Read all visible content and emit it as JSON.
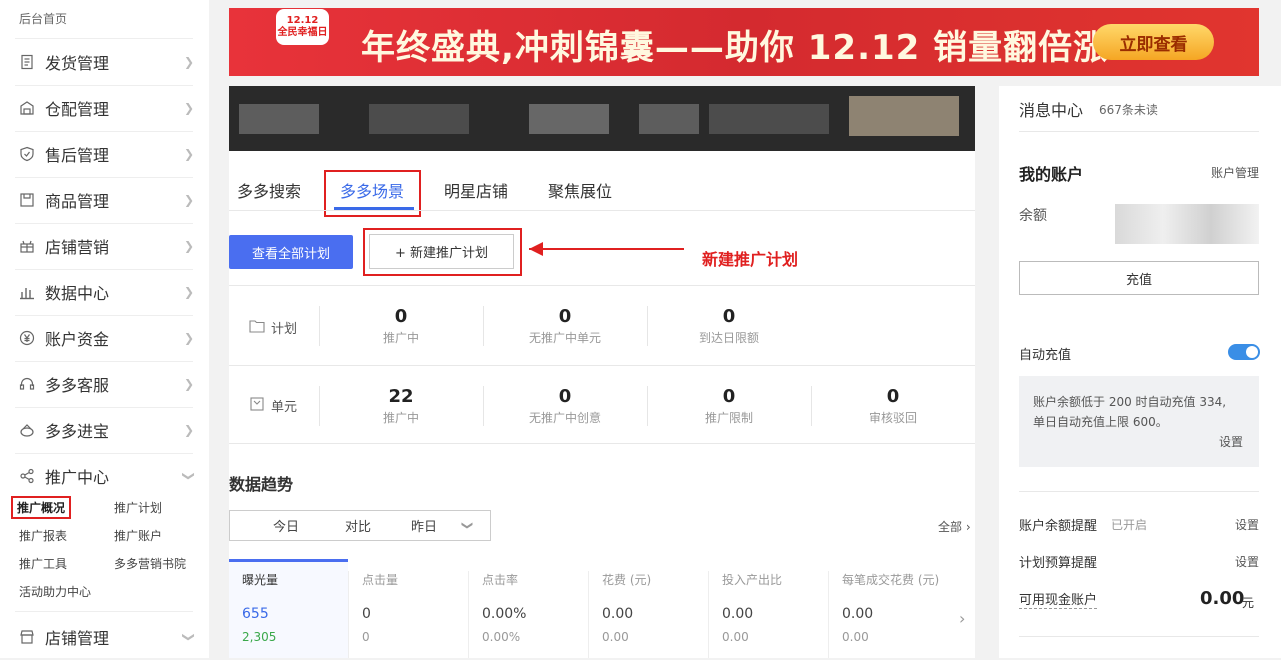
{
  "sidebar": {
    "home": "后台首页",
    "items": [
      {
        "label": "发货管理",
        "icon": "document-icon"
      },
      {
        "label": "仓配管理",
        "icon": "warehouse-icon"
      },
      {
        "label": "售后管理",
        "icon": "shield-icon"
      },
      {
        "label": "商品管理",
        "icon": "product-icon"
      },
      {
        "label": "店铺营销",
        "icon": "gift-icon"
      },
      {
        "label": "数据中心",
        "icon": "bar-chart-icon"
      },
      {
        "label": "账户资金",
        "icon": "yen-icon"
      },
      {
        "label": "多多客服",
        "icon": "headset-icon"
      },
      {
        "label": "多多进宝",
        "icon": "treasure-icon"
      },
      {
        "label": "推广中心",
        "icon": "share-icon"
      }
    ],
    "promo_sub": [
      "推广概况",
      "推广计划",
      "推广报表",
      "推广账户",
      "推广工具",
      "多多营销书院",
      "活动助力中心"
    ],
    "last_item": "店铺管理"
  },
  "banner": {
    "logo_line1": "12.12",
    "logo_line2": "全民幸福日",
    "headline": "年终盛典,冲刺锦囊——助你 12.12 销量翻倍涨!",
    "button": "立即查看"
  },
  "tabs": [
    "多多搜索",
    "多多场景",
    "明星店铺",
    "聚焦展位"
  ],
  "actions": {
    "view_all": "查看全部计划",
    "new_plan": "+ 新建推广计划"
  },
  "annotation": "新建推广计划",
  "plan_stats": {
    "label": "计划",
    "cells": [
      {
        "value": "0",
        "caption": "推广中"
      },
      {
        "value": "0",
        "caption": "无推广中单元"
      },
      {
        "value": "0",
        "caption": "到达日限额"
      }
    ]
  },
  "unit_stats": {
    "label": "单元",
    "cells": [
      {
        "value": "22",
        "caption": "推广中"
      },
      {
        "value": "0",
        "caption": "无推广中创意"
      },
      {
        "value": "0",
        "caption": "推广限制"
      },
      {
        "value": "0",
        "caption": "审核驳回"
      }
    ]
  },
  "trend": {
    "title": "数据趋势",
    "seg_today": "今日",
    "seg_compare": "对比",
    "seg_yesterday": "昨日",
    "all_link": "全部",
    "metrics": [
      {
        "name": "曝光量",
        "value": "655",
        "prev": "2,305"
      },
      {
        "name": "点击量",
        "value": "0",
        "prev": "0"
      },
      {
        "name": "点击率",
        "value": "0.00%",
        "prev": "0.00%"
      },
      {
        "name": "花费 (元)",
        "value": "0.00",
        "prev": "0.00"
      },
      {
        "name": "投入产出比",
        "value": "0.00",
        "prev": "0.00"
      },
      {
        "name": "每笔成交花费 (元)",
        "value": "0.00",
        "prev": "0.00"
      }
    ]
  },
  "right": {
    "msg_title": "消息中心",
    "msg_unread": "667条未读",
    "account_title": "我的账户",
    "account_manage": "账户管理",
    "balance_label": "余额",
    "recharge": "充值",
    "auto_recharge": "自动充值",
    "auto_note_1": "账户余额低于 200 时自动充值 334,",
    "auto_note_2": "单日自动充值上限 600。",
    "auto_setting": "设置",
    "balance_alert": "账户余额提醒",
    "balance_alert_status": "已开启",
    "balance_alert_setting": "设置",
    "budget_alert": "计划预算提醒",
    "budget_alert_setting": "设置",
    "cash_account": "可用现金账户",
    "cash_value": "0.00",
    "cash_unit": "元"
  },
  "colors": {
    "accent": "#4a6ef0",
    "annotation": "#e02020",
    "banner": "#e02d2f"
  }
}
